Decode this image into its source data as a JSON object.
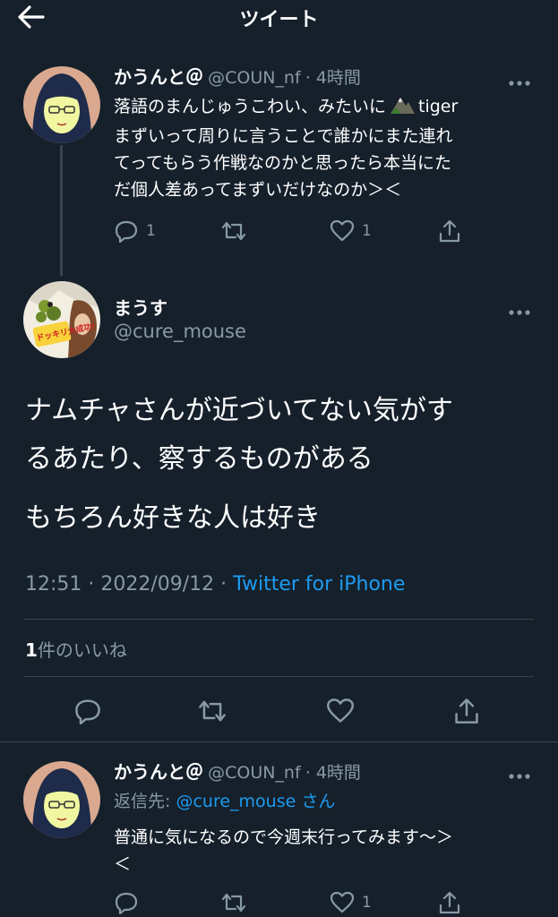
{
  "header": {
    "title": "ツイート",
    "back_icon": "arrow-left-icon"
  },
  "parent_tweet": {
    "display_name": "かうんと＠",
    "handle": "@COUN_nf",
    "time": "· 4時間",
    "text_lines": [
      "落語のまんじゅうこわい、みたいに",
      "まずいって周りに言うことで誰かにまた連れ",
      "てってもらう作戦なのかと思ったら本当にた",
      "だ個人差あってまずいだけなのか＞＜"
    ],
    "tiger_word": "tiger",
    "reply_count": "1",
    "like_count": "1"
  },
  "main_tweet": {
    "display_name": "まうす",
    "handle": "@cure_mouse",
    "text_line1": "ナムチャさんが近づいてない気がす",
    "text_line2": "るあたり、察するものがある",
    "text_line3": "もちろん好きな人は好き",
    "timestamp": "12:51 · 2022/09/12 · ",
    "source": "Twitter for iPhone",
    "likes_number": "1",
    "likes_label": "件のいいね",
    "avatar_badge": "ドッキリ大成功!"
  },
  "reply_tweet": {
    "display_name": "かうんと＠",
    "handle": "@COUN_nf",
    "time": "· 4時間",
    "reply_prefix": "返信先: ",
    "reply_to": "@cure_mouse",
    "reply_suffix": " さん",
    "text_line1": "普通に気になるので今週末行ってみます～＞",
    "text_line2": "＜",
    "like_count": "1"
  },
  "colors": {
    "background": "#15202b",
    "muted": "#8899a6",
    "link": "#1d9bf0",
    "divider": "#38444d"
  }
}
